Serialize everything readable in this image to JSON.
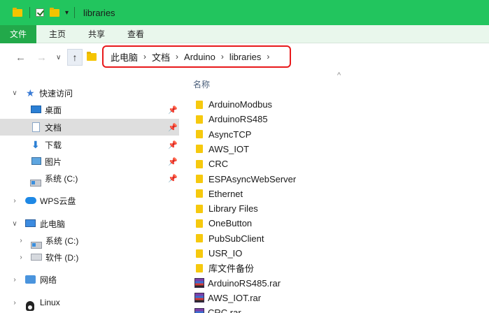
{
  "window": {
    "title": "libraries"
  },
  "ribbon": {
    "tabs": [
      {
        "label": "文件"
      },
      {
        "label": "主页"
      },
      {
        "label": "共享"
      },
      {
        "label": "查看"
      }
    ]
  },
  "nav": {
    "back": "←",
    "forward": "→",
    "recent": "∨",
    "up": "↑"
  },
  "address": {
    "crumbs": [
      "此电脑",
      "文档",
      "Arduino",
      "libraries"
    ],
    "separator": "›"
  },
  "sidebar": {
    "quick_access": "快速访问",
    "items": [
      {
        "label": "桌面",
        "icon": "desktop-icon",
        "pinned": true
      },
      {
        "label": "文档",
        "icon": "documents-icon",
        "pinned": true
      },
      {
        "label": "下载",
        "icon": "download-icon",
        "pinned": true
      },
      {
        "label": "图片",
        "icon": "pictures-icon",
        "pinned": true
      },
      {
        "label": "系统 (C:)",
        "icon": "drive-icon",
        "pinned": true
      }
    ],
    "wps": "WPS云盘",
    "this_pc": "此电脑",
    "pc_items": [
      {
        "label": "系统 (C:)",
        "icon": "drive-icon"
      },
      {
        "label": "软件 (D:)",
        "icon": "drive-icon"
      }
    ],
    "network": "网络",
    "linux": "Linux"
  },
  "filelist": {
    "column_name": "名称",
    "sort_indicator": "^",
    "items": [
      {
        "name": "ArduinoModbus",
        "type": "folder"
      },
      {
        "name": "ArduinoRS485",
        "type": "folder"
      },
      {
        "name": "AsyncTCP",
        "type": "folder"
      },
      {
        "name": "AWS_IOT",
        "type": "folder"
      },
      {
        "name": "CRC",
        "type": "folder"
      },
      {
        "name": "ESPAsyncWebServer",
        "type": "folder"
      },
      {
        "name": "Ethernet",
        "type": "folder"
      },
      {
        "name": "Library Files",
        "type": "folder"
      },
      {
        "name": "OneButton",
        "type": "folder"
      },
      {
        "name": "PubSubClient",
        "type": "folder"
      },
      {
        "name": "USR_IO",
        "type": "folder"
      },
      {
        "name": "库文件备份",
        "type": "folder"
      },
      {
        "name": "ArduinoRS485.rar",
        "type": "rar"
      },
      {
        "name": "AWS_IOT.rar",
        "type": "rar"
      },
      {
        "name": "CRC.rar",
        "type": "rar"
      }
    ]
  },
  "colors": {
    "titlebar": "#22c55e",
    "ribbon_file_tab": "#22a94a",
    "highlight_box": "#e8191b",
    "folder": "#f6c90e"
  }
}
